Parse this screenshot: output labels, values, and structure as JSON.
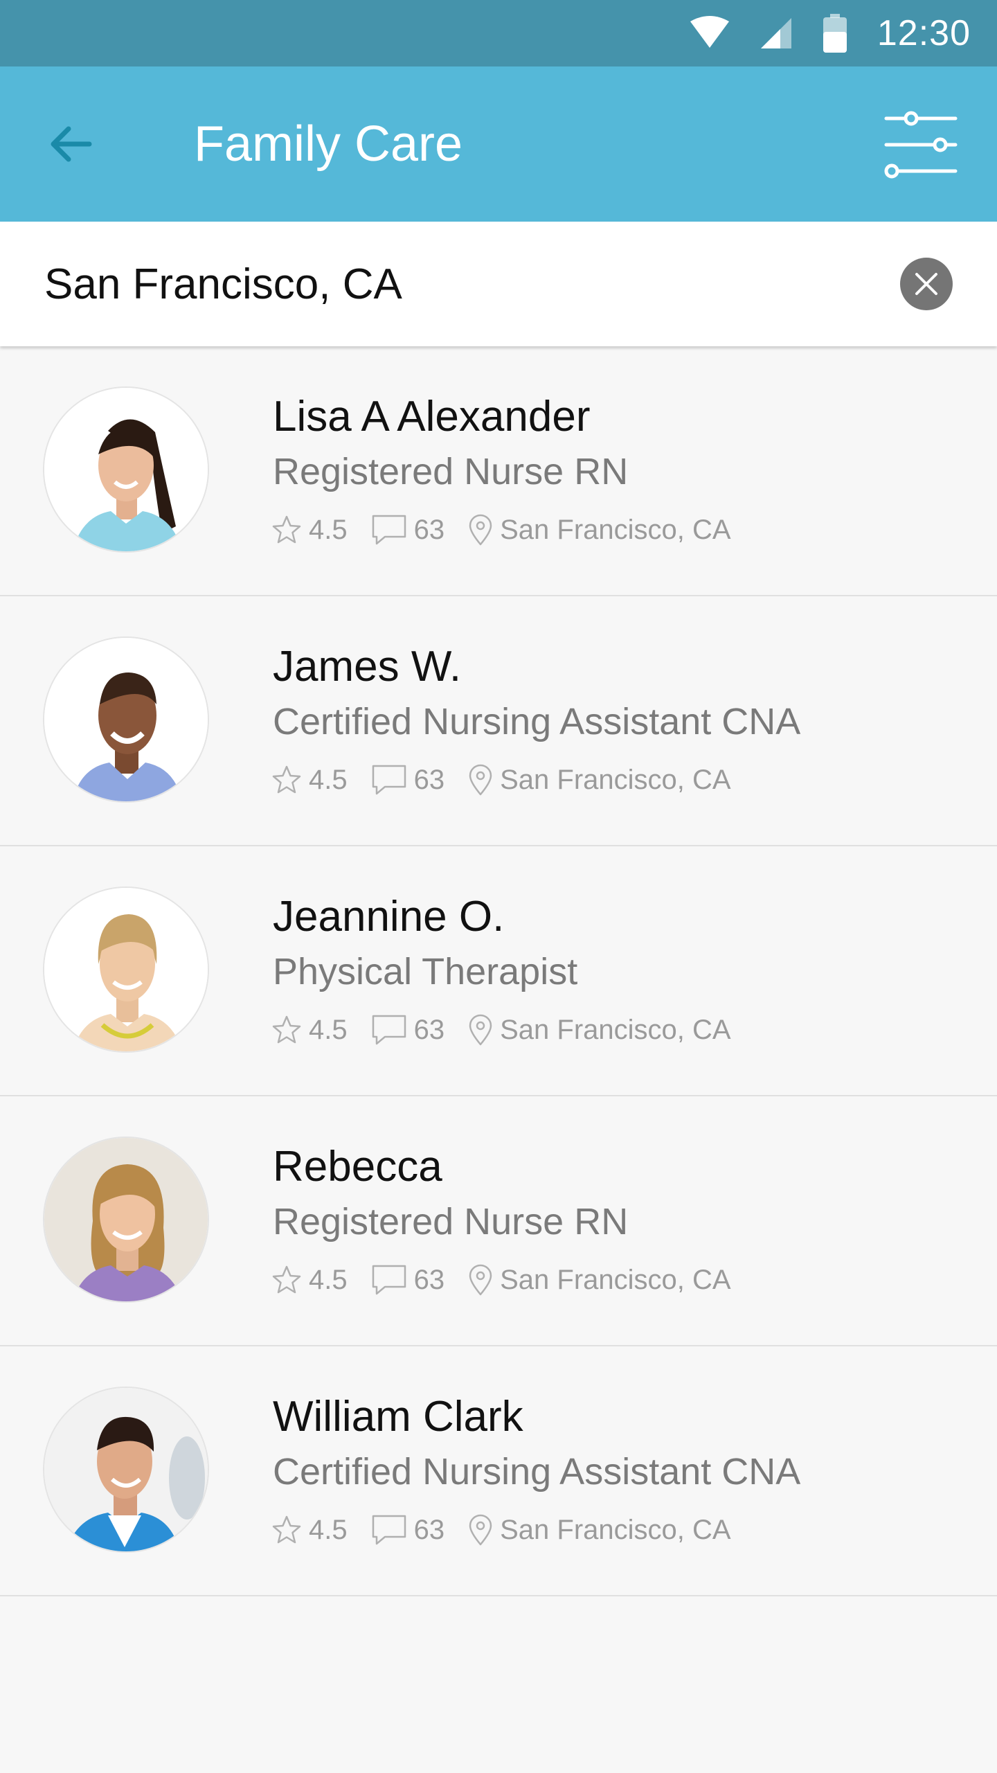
{
  "status_bar": {
    "time": "12:30",
    "icons": [
      "wifi-icon",
      "cell-signal-icon",
      "battery-icon"
    ]
  },
  "app_bar": {
    "title": "Family Care",
    "back_icon": "arrow-left-icon",
    "filter_icon": "filter-sliders-icon",
    "color": "#55b8d8",
    "status_color": "#4593ab"
  },
  "search": {
    "value": "San Francisco, CA",
    "clear_icon": "close-icon"
  },
  "caregivers": [
    {
      "name": "Lisa A Alexander",
      "role": "Registered Nurse RN",
      "rating": "4.5",
      "reviews": "63",
      "location": "San Francisco, CA"
    },
    {
      "name": "James W.",
      "role": "Certified Nursing Assistant CNA",
      "rating": "4.5",
      "reviews": "63",
      "location": "San Francisco, CA"
    },
    {
      "name": "Jeannine O.",
      "role": "Physical Therapist",
      "rating": "4.5",
      "reviews": "63",
      "location": "San Francisco, CA"
    },
    {
      "name": "Rebecca",
      "role": "Registered Nurse RN",
      "rating": "4.5",
      "reviews": "63",
      "location": "San Francisco, CA"
    },
    {
      "name": "William Clark",
      "role": "Certified Nursing Assistant CNA",
      "rating": "4.5",
      "reviews": "63",
      "location": "San Francisco, CA"
    }
  ]
}
